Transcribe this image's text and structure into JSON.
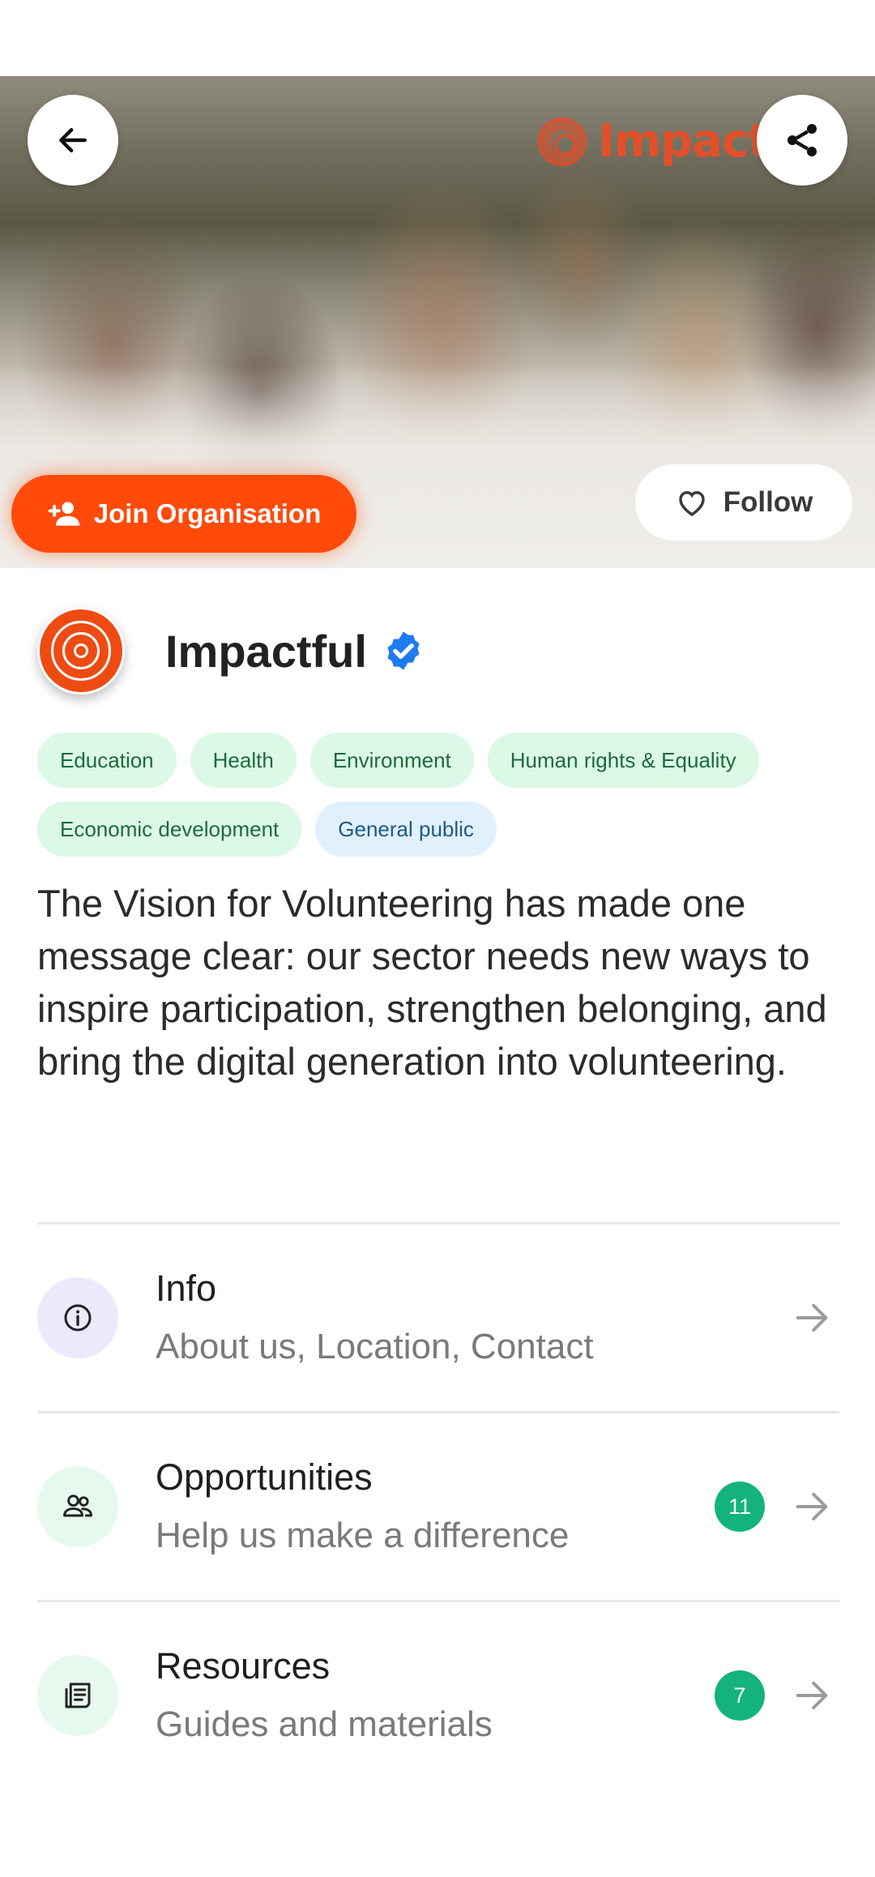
{
  "hero": {
    "logo_text": "Impact",
    "join_label": "Join Organisation",
    "follow_label": "Follow"
  },
  "organisation": {
    "name": "Impactful",
    "verified": true,
    "description": "The Vision for Volunteering has made one message clear: our sector needs new ways to inspire participation, strengthen belonging, and bring the digital generation into volunteering."
  },
  "tags": [
    {
      "label": "Education",
      "color": "#dcf8e6"
    },
    {
      "label": "Health",
      "color": "#dcf8e6"
    },
    {
      "label": "Environment",
      "color": "#dcf8e6"
    },
    {
      "label": "Human rights & Equality",
      "color": "#dcf8e6"
    },
    {
      "label": "Economic development",
      "color": "#dcf8e6"
    },
    {
      "label": "General public",
      "color": "#e0f0fc"
    }
  ],
  "menu": [
    {
      "title": "Info",
      "subtitle": "About us, Location, Contact",
      "icon": "info-icon"
    },
    {
      "title": "Opportunities",
      "subtitle": "Help us make a difference",
      "count": "11",
      "icon": "people-icon"
    },
    {
      "title": "Resources",
      "subtitle": "Guides and materials",
      "count": "7",
      "icon": "document-icon"
    }
  ],
  "colors": {
    "accent": "#ff4a0a",
    "verified": "#1e7bf0",
    "badge": "#14b37d"
  }
}
